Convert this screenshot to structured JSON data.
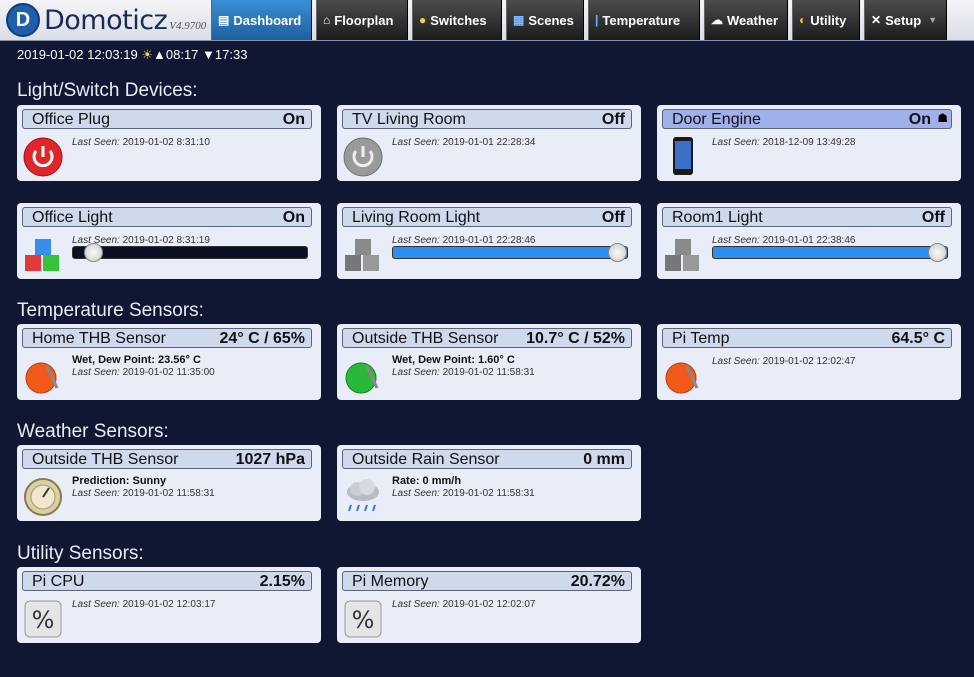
{
  "app": {
    "name": "Domoticz",
    "version": "V4.9700"
  },
  "nav": [
    {
      "label": "Dashboard",
      "icon": "dashboard-icon",
      "glyph": "▤",
      "active": true
    },
    {
      "label": "Floorplan",
      "icon": "house-icon",
      "glyph": "⌂"
    },
    {
      "label": "Switches",
      "icon": "bulb-icon",
      "glyph": "●"
    },
    {
      "label": "Scenes",
      "icon": "clapper-icon",
      "glyph": "▦"
    },
    {
      "label": "Temperature",
      "icon": "thermometer-icon",
      "glyph": "🌡"
    },
    {
      "label": "Weather",
      "icon": "cloud-rain-icon",
      "glyph": "☁"
    },
    {
      "label": "Utility",
      "icon": "utility-icon",
      "glyph": "◐"
    },
    {
      "label": "Setup",
      "icon": "tools-icon",
      "glyph": "✕"
    }
  ],
  "status": {
    "datetime": "2019-01-02 12:03:19",
    "sunrise": "08:17",
    "sunset": "17:33"
  },
  "sections": {
    "lights": "Light/Switch Devices:",
    "temp": "Temperature Sensors:",
    "weather": "Weather Sensors:",
    "utility": "Utility Sensors:"
  },
  "seen_label": "Last Seen:",
  "devices": {
    "office_plug": {
      "name": "Office Plug",
      "value": "On",
      "seen": "2019-01-02 8:31:10"
    },
    "tv_living": {
      "name": "TV Living Room",
      "value": "Off",
      "seen": "2019-01-01 22:28:34"
    },
    "door_engine": {
      "name": "Door Engine",
      "value": "On",
      "seen": "2018-12-09 13:49:28"
    },
    "office_light": {
      "name": "Office Light",
      "value": "On",
      "seen": "2019-01-02 8:31:19",
      "level": 0.05
    },
    "living_light": {
      "name": "Living Room Light",
      "value": "Off",
      "seen": "2019-01-01 22:28:46",
      "level": 1.0
    },
    "room1_light": {
      "name": "Room1 Light",
      "value": "Off",
      "seen": "2019-01-01 22:38:46",
      "level": 1.0
    },
    "home_thb": {
      "name": "Home THB Sensor",
      "value": "24° C / 65%",
      "line1": "Wet, Dew Point: 23.56° C",
      "seen": "2019-01-02 11:35:00"
    },
    "outside_thb": {
      "name": "Outside THB Sensor",
      "value": "10.7° C / 52%",
      "line1": "Wet, Dew Point: 1.60° C",
      "seen": "2019-01-02 11:58:31"
    },
    "pi_temp": {
      "name": "Pi Temp",
      "value": "64.5° C",
      "seen": "2019-01-02 12:02:47"
    },
    "outside_baro": {
      "name": "Outside THB Sensor",
      "value": "1027 hPa",
      "line1": "Prediction: Sunny",
      "seen": "2019-01-02 11:58:31"
    },
    "rain": {
      "name": "Outside Rain Sensor",
      "value": "0 mm",
      "line1": "Rate: 0 mm/h",
      "seen": "2019-01-02 11:58:31"
    },
    "pi_cpu": {
      "name": "Pi CPU",
      "value": "2.15%",
      "seen": "2019-01-02 12:03:17"
    },
    "pi_mem": {
      "name": "Pi Memory",
      "value": "20.72%",
      "seen": "2019-01-02 12:02:07"
    }
  },
  "colors": {
    "background": "#0f1733",
    "nav_active": "#2f7fc8",
    "card": "#e8edf7",
    "header_on": "#9fb0ea"
  }
}
